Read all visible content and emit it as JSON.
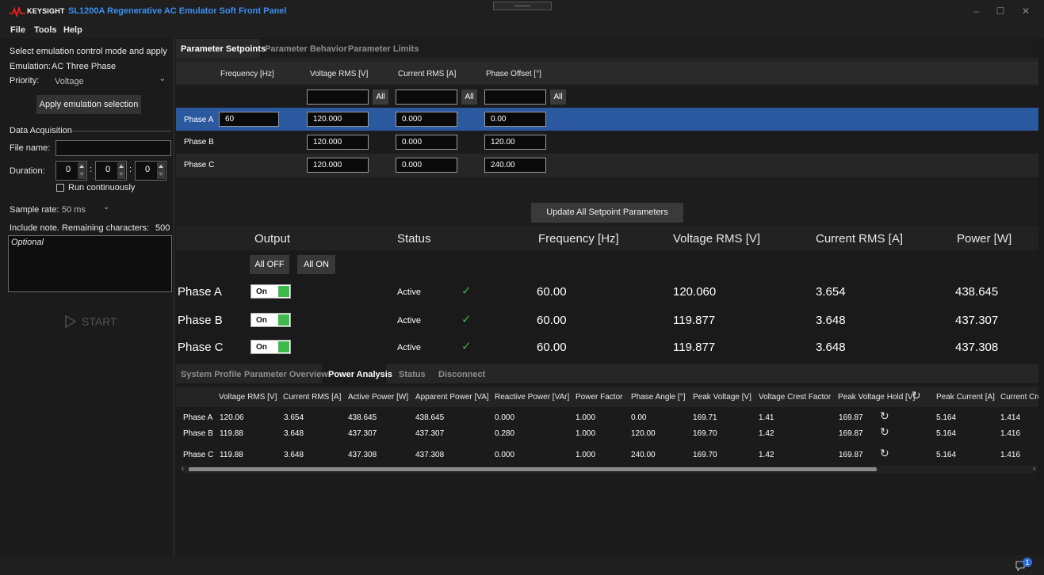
{
  "app": {
    "brand": "KEYSIGHT",
    "title": "SL1200A Regenerative AC Emulator Soft Front Panel"
  },
  "window": {
    "minimize": "–",
    "maximize": "☐",
    "close": "✕"
  },
  "menu": [
    "File",
    "Tools",
    "Help"
  ],
  "left": {
    "heading": "Select emulation control mode and apply",
    "emulation_label": "Emulation:",
    "emulation_value": "AC Three Phase",
    "priority_label": "Priority:",
    "priority_value": "Voltage",
    "apply_button": "Apply emulation selection",
    "data_acq_label": "Data Acquisition",
    "file_name_label": "File name:",
    "file_name_value": "",
    "duration_label": "Duration:",
    "duration": [
      "0",
      "0",
      "0"
    ],
    "colon": ":",
    "run_continuously": "Run continuously",
    "sample_rate_label": "Sample rate:",
    "sample_rate_value": "50 ms",
    "note_label": "Include note. Remaining characters:",
    "note_remaining": "500",
    "note_placeholder": "Optional",
    "start_button": "START"
  },
  "setpoints": {
    "tabs": [
      "Parameter Setpoints",
      "Parameter Behavior",
      "Parameter Limits"
    ],
    "columns": [
      "Frequency [Hz]",
      "Voltage RMS [V]",
      "Current RMS [A]",
      "Phase Offset [°]"
    ],
    "all_label": "All",
    "rows": [
      {
        "phase": "Phase A",
        "frequency": "60",
        "voltage": "120.000",
        "current": "0.000",
        "offset": "0.00"
      },
      {
        "phase": "Phase B",
        "frequency": "",
        "voltage": "120.000",
        "current": "0.000",
        "offset": "120.00"
      },
      {
        "phase": "Phase C",
        "frequency": "",
        "voltage": "120.000",
        "current": "0.000",
        "offset": "240.00"
      }
    ],
    "update_button": "Update All Setpoint Parameters"
  },
  "output": {
    "headers": [
      "Output",
      "Status",
      "Frequency [Hz]",
      "Voltage RMS [V]",
      "Current RMS [A]",
      "Power [W]"
    ],
    "all_off": "All OFF",
    "all_on": "All ON",
    "rows": [
      {
        "phase": "Phase A",
        "toggle": "On",
        "status": "Active",
        "frequency": "60.00",
        "voltage": "120.060",
        "current": "3.654",
        "power": "438.645"
      },
      {
        "phase": "Phase B",
        "toggle": "On",
        "status": "Active",
        "frequency": "60.00",
        "voltage": "119.877",
        "current": "3.648",
        "power": "437.307"
      },
      {
        "phase": "Phase C",
        "toggle": "On",
        "status": "Active",
        "frequency": "60.00",
        "voltage": "119.877",
        "current": "3.648",
        "power": "437.308"
      }
    ]
  },
  "analysis": {
    "tabs": [
      "System Profile",
      "Parameter Overview",
      "Power Analysis",
      "Status",
      "Disconnect"
    ],
    "columns": [
      "Voltage RMS [V]",
      "Current RMS [A]",
      "Active Power [W]",
      "Apparent Power [VA]",
      "Reactive Power [VAr]",
      "Power Factor",
      "Phase Angle [°]",
      "Peak Voltage [V]",
      "Voltage Crest Factor",
      "Peak Voltage Hold [V]",
      "Peak Current [A]",
      "Current Cres"
    ],
    "rows": [
      {
        "phase": "Phase A",
        "cells": [
          "120.06",
          "3.654",
          "438.645",
          "438.645",
          "0.000",
          "1.000",
          "0.00",
          "169.71",
          "1.41",
          "169.87",
          "5.164",
          "1.414"
        ]
      },
      {
        "phase": "Phase B",
        "cells": [
          "119.88",
          "3.648",
          "437.307",
          "437.307",
          "0.280",
          "1.000",
          "120.00",
          "169.70",
          "1.42",
          "169.87",
          "5.164",
          "1.416"
        ]
      },
      {
        "phase": "Phase C",
        "cells": [
          "119.88",
          "3.648",
          "437.308",
          "437.308",
          "0.000",
          "1.000",
          "240.00",
          "169.70",
          "1.42",
          "169.87",
          "5.164",
          "1.416"
        ]
      }
    ]
  },
  "notifications": {
    "count": "1"
  },
  "colors": {
    "accent": "#3d8ff3",
    "selected_row": "#2b59a0",
    "on_toggle": "#3eb94b",
    "active_check": "#3fae4d"
  }
}
